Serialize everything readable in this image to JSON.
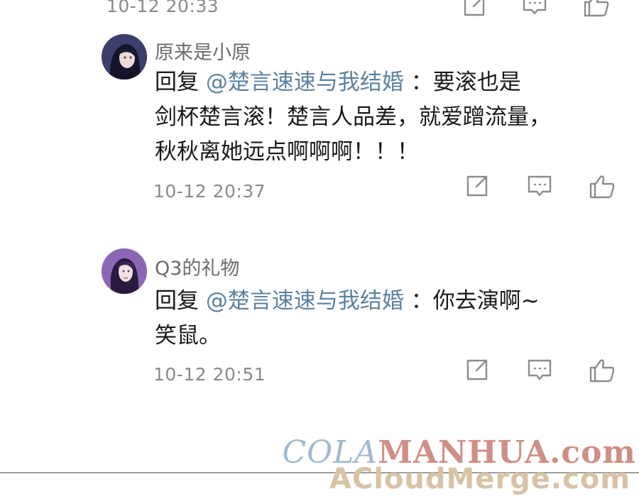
{
  "top_comment": {
    "time": "10-12  20:33"
  },
  "comments": [
    {
      "username": "原来是小原",
      "reply_prefix": "回复",
      "mention": "@楚言速速与我结婚",
      "separator": "：",
      "lines": [
        "要滚也是",
        "剑杯楚言滚！楚言人品差，就爱蹭流量，",
        "秋秋离她远点啊啊啊！！！"
      ],
      "time": "10-12  20:37"
    },
    {
      "username": "Q3的礼物",
      "reply_prefix": "回复",
      "mention": "@楚言速速与我结婚",
      "separator": "：",
      "lines": [
        "你去演啊~",
        "笑鼠。"
      ],
      "time": "10-12  20:51"
    }
  ],
  "icons": {
    "share": "share-icon",
    "reply": "comment-icon",
    "like": "thumbs-up-icon"
  },
  "watermark": {
    "line1_a": "COLA",
    "line1_b": "MANHUA.com",
    "line2": "ACloudMerge.com"
  }
}
